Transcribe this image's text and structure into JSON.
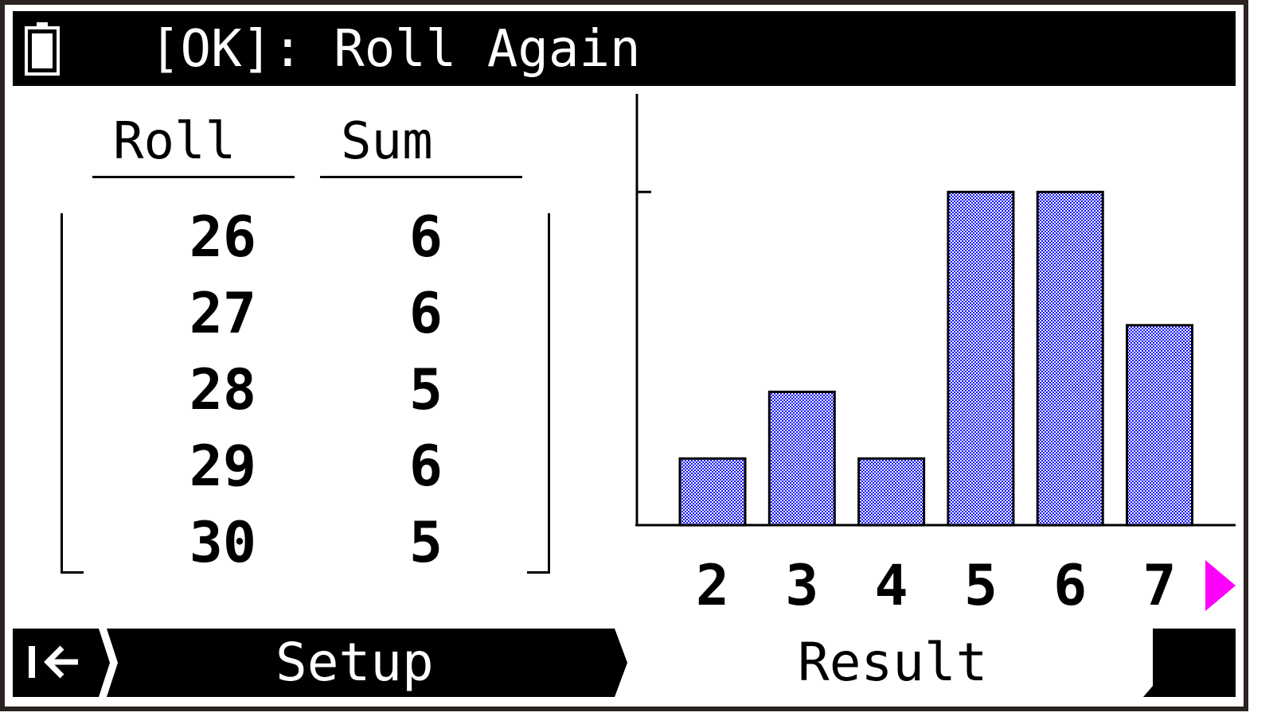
{
  "title": "[OK]: Roll Again",
  "status": {
    "battery_icon": "battery-icon"
  },
  "table": {
    "headers": [
      "Roll",
      "Sum"
    ],
    "rows": [
      [
        "26",
        "6"
      ],
      [
        "27",
        "6"
      ],
      [
        "28",
        "5"
      ],
      [
        "29",
        "6"
      ],
      [
        "30",
        "5"
      ]
    ]
  },
  "chart_data": {
    "type": "bar",
    "categories": [
      "2",
      "3",
      "4",
      "5",
      "6",
      "7"
    ],
    "values": [
      1,
      2,
      1,
      5,
      5,
      3
    ],
    "ylim": [
      0,
      6.4
    ],
    "yticks": [
      5
    ],
    "grid": false,
    "bar_fill": "#1010ff",
    "bar_pattern": "checkered"
  },
  "scroll_indicator": {
    "icon": "scroll-right-arrow-icon",
    "color": "#ff00ff"
  },
  "tabs": [
    {
      "label": "Setup",
      "active": false
    },
    {
      "label": "Result",
      "active": true
    }
  ],
  "back_icon": "back-to-start-icon"
}
